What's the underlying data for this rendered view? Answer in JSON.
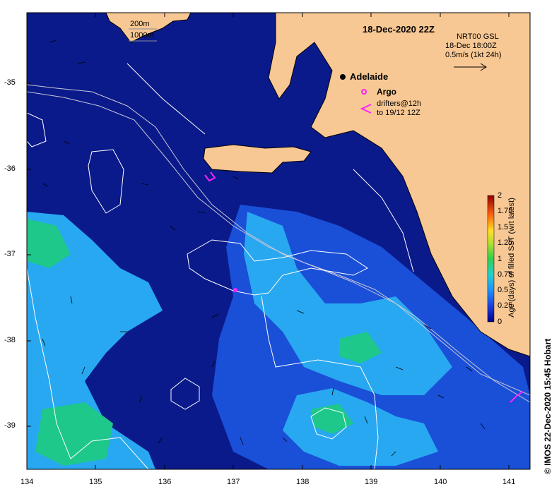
{
  "map": {
    "title": "18-Dec-2020 22Z",
    "contour_legend": [
      "200m",
      "1000m"
    ],
    "product": {
      "name": "NRT00 GSL",
      "time": "18-Dec 18:00Z",
      "scale": "0.5m/s (1kt 24h)"
    },
    "city": "Adelaide",
    "legend_argo": "Argo",
    "legend_drifters": [
      "drifters@12h",
      "to 19/12 12Z"
    ],
    "credit": "© IMOS 22-Dec-2020 15:45 Hobart",
    "x_ticks": [
      "134",
      "135",
      "136",
      "137",
      "138",
      "139",
      "140",
      "141"
    ],
    "y_ticks": [
      "-35",
      "-36",
      "-37",
      "-38",
      "-39"
    ],
    "colorbar": {
      "label": "Age (days) of filled SST (wrt latest)",
      "ticks": [
        "2",
        "1.75",
        "1.5",
        "1.25",
        "1",
        "0.75",
        "0.5",
        "0.25",
        "0"
      ]
    },
    "colors": {
      "land": "#f8c894",
      "deep_sst": "#0a1a8a",
      "sst_blue": "#1a4fd8",
      "sst_cyan": "#28a8f0",
      "sst_green": "#1ec88a",
      "argo": "#ff22ff"
    }
  }
}
